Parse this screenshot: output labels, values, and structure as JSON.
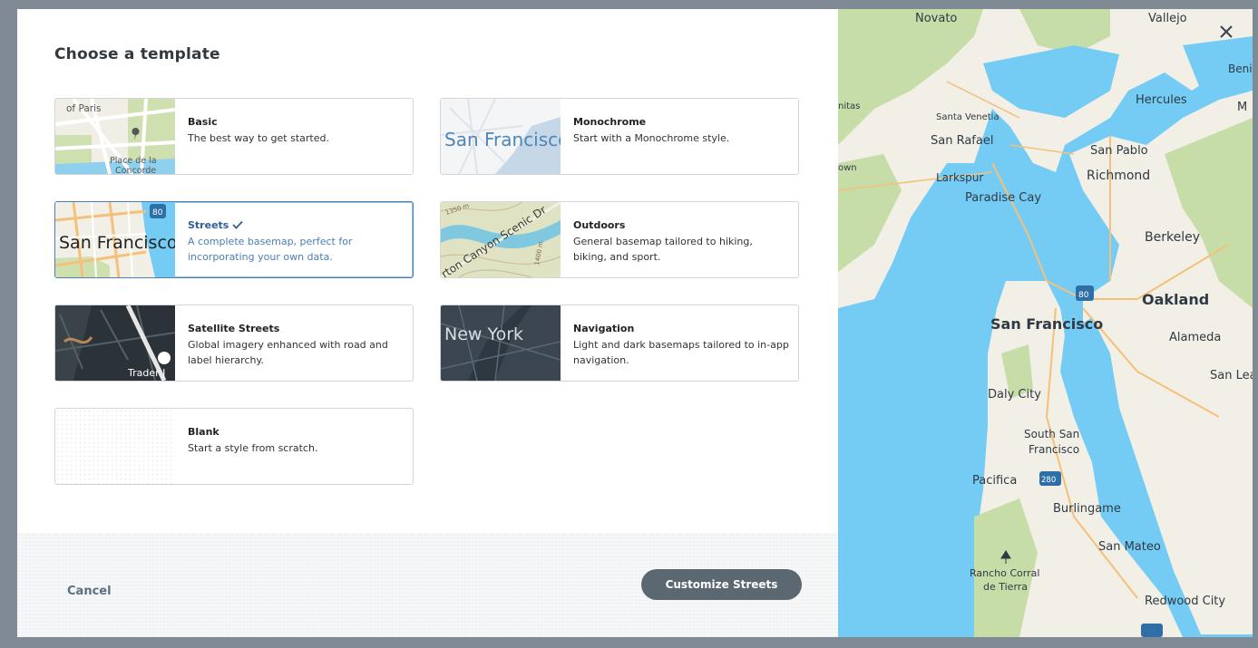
{
  "dialog": {
    "title": "Choose a template",
    "templates": [
      {
        "name": "Basic",
        "description": "The best way to get started.",
        "selected": false,
        "thumb_labels": [
          "of Paris",
          "Place de la",
          "Concorde"
        ]
      },
      {
        "name": "Monochrome",
        "description": "Start with a Monochrome style.",
        "selected": false,
        "thumb_labels": [
          "San Francisco"
        ]
      },
      {
        "name": "Streets",
        "description": "A complete basemap, perfect for incorporating your own data.",
        "selected": true,
        "thumb_labels": [
          "San Francisco",
          "80"
        ]
      },
      {
        "name": "Outdoors",
        "description": "General basemap tailored to hiking, biking, and sport.",
        "selected": false,
        "thumb_labels": [
          "rton Canyon Scenic Dr",
          "1350 m",
          "1400 m"
        ]
      },
      {
        "name": "Satellite Streets",
        "description": "Global imagery enhanced with road and label hierarchy.",
        "selected": false,
        "thumb_labels": [
          "Trader J"
        ]
      },
      {
        "name": "Navigation",
        "description": "Light and dark basemaps tailored to in-app navigation.",
        "selected": false,
        "thumb_labels": [
          "New York"
        ]
      },
      {
        "name": "Blank",
        "description": "Start a style from scratch.",
        "selected": false,
        "thumb_labels": []
      }
    ],
    "cancel_label": "Cancel",
    "primary_label": "Customize Streets"
  },
  "preview_map": {
    "labels": {
      "novato": "Novato",
      "vallejo": "Vallejo",
      "benicia": "Beni",
      "hercules": "Hercules",
      "santa_venetia": "Santa Venetia",
      "san_rafael": "San Rafael",
      "san_pablo": "San Pablo",
      "richmond": "Richmond",
      "larkspur": "Larkspur",
      "paradise_cay": "Paradise Cay",
      "berkeley": "Berkeley",
      "oakland": "Oakland",
      "san_francisco": "San Francisco",
      "alameda": "Alameda",
      "san_leandro": "San Lea",
      "daly_city": "Daly City",
      "south_sf_1": "South San",
      "south_sf_2": "Francisco",
      "pacifica": "Pacifica",
      "burlingame": "Burlingame",
      "san_mateo": "San Mateo",
      "rancho_1": "Rancho Corral",
      "rancho_2": "de Tierra",
      "redwood_city": "Redwood City",
      "nitas": "nitas",
      "own": "own",
      "m_edge": "M",
      "shield_80": "80",
      "shield_280": "280"
    }
  },
  "colors": {
    "water": "#74ccf4",
    "land": "#f2efe6",
    "park": "#c7dda8",
    "selected_border": "#4a7fb8",
    "primary_button": "#5b6872"
  }
}
